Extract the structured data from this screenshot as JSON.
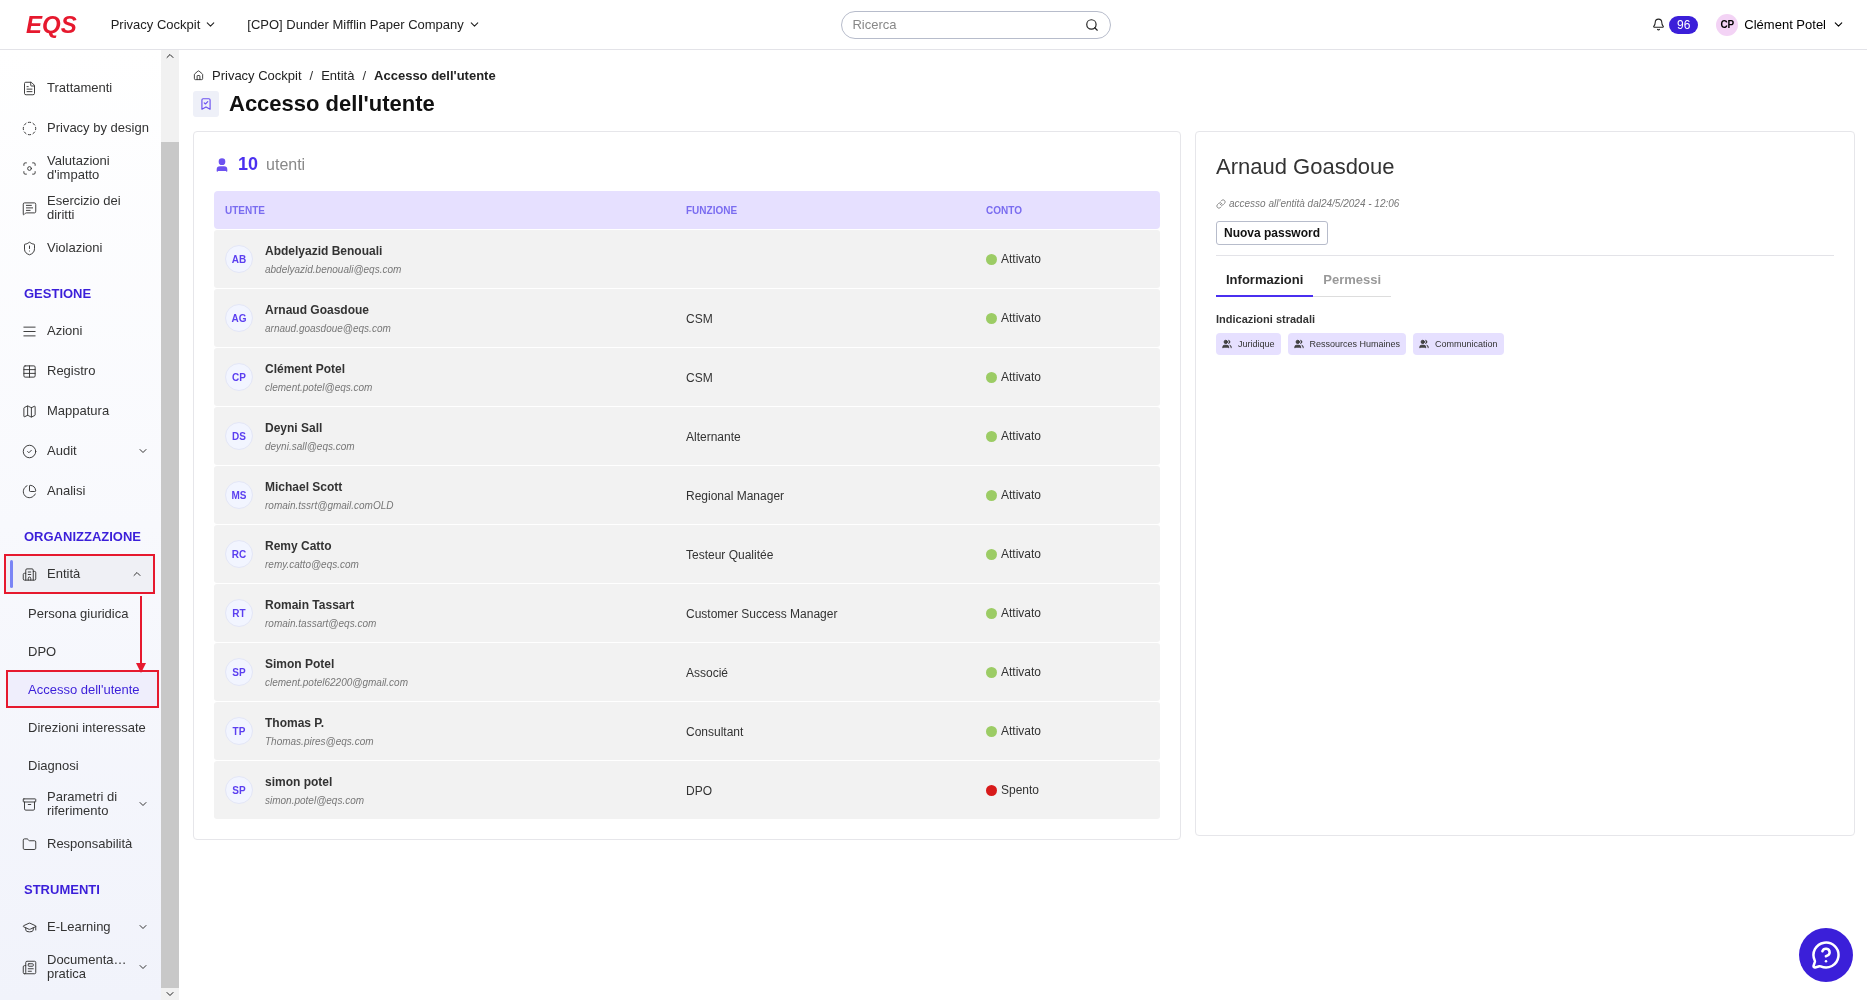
{
  "topbar": {
    "logo": "EQS",
    "menus": [
      {
        "label": "Privacy Cockpit"
      },
      {
        "label": "[CPO] Dunder Mifflin Paper Company"
      }
    ],
    "search": {
      "placeholder": "Ricerca"
    },
    "notifications": "96",
    "user": {
      "initials": "CP",
      "name": "Clément Potel"
    }
  },
  "sidebar": {
    "sections": [
      {
        "items": [
          {
            "label": "Trattamenti"
          },
          {
            "label": "Privacy by design"
          },
          {
            "label": "Valutazioni d'impatto"
          },
          {
            "label": "Esercizio dei diritti"
          },
          {
            "label": "Violazioni"
          }
        ]
      },
      {
        "title": "GESTIONE",
        "items": [
          {
            "label": "Azioni"
          },
          {
            "label": "Registro"
          },
          {
            "label": "Mappatura"
          },
          {
            "label": "Audit",
            "expanded": false
          },
          {
            "label": "Analisi"
          }
        ]
      },
      {
        "title": "ORGANIZZAZIONE",
        "items": [
          {
            "label": "Entità",
            "expanded": true,
            "active": true,
            "annotated": true,
            "children": [
              {
                "label": "Persona giuridica",
                "selected": false,
                "annotated": false
              },
              {
                "label": "DPO",
                "selected": false,
                "annotated": false
              },
              {
                "label": "Accesso dell'utente",
                "selected": true,
                "annotated": true
              },
              {
                "label": "Direzioni interessate",
                "selected": false,
                "annotated": false
              },
              {
                "label": "Diagnosi",
                "selected": false,
                "annotated": false
              }
            ]
          },
          {
            "label": "Parametri di riferimento",
            "expanded": false
          },
          {
            "label": "Responsabilità"
          }
        ]
      },
      {
        "title": "STRUMENTI",
        "items": [
          {
            "label": "E-Learning",
            "expanded": false
          },
          {
            "label": "Documenta… pratica",
            "expanded": false
          }
        ]
      }
    ]
  },
  "breadcrumb": [
    {
      "label": "Privacy Cockpit"
    },
    {
      "separator": "/",
      "label": "Entità"
    },
    {
      "separator": "/",
      "label": "Accesso dell'utente"
    }
  ],
  "page_title": "Accesso dell'utente",
  "users_panel": {
    "count": "10",
    "count_label": "utenti",
    "table": {
      "columns": [
        "UTENTE",
        "FUNZIONE",
        "CONTO"
      ],
      "rows": [
        {
          "initials": "AB",
          "name": "Abdelyazid Benouali",
          "email": "abdelyazid.benouali@eqs.com",
          "function": "",
          "status": {
            "label": "Attivato",
            "color": "#9ccc65"
          }
        },
        {
          "initials": "AG",
          "name": "Arnaud Goasdoue",
          "email": "arnaud.goasdoue@eqs.com",
          "function": "CSM",
          "status": {
            "label": "Attivato",
            "color": "#9ccc65"
          }
        },
        {
          "initials": "CP",
          "name": "Clément Potel",
          "email": "clement.potel@eqs.com",
          "function": "CSM",
          "status": {
            "label": "Attivato",
            "color": "#9ccc65"
          }
        },
        {
          "initials": "DS",
          "name": "Deyni Sall",
          "email": "deyni.sall@eqs.com",
          "function": "Alternante",
          "status": {
            "label": "Attivato",
            "color": "#9ccc65"
          }
        },
        {
          "initials": "MS",
          "name": "Michael Scott",
          "email": "romain.tssrt@gmail.comOLD",
          "function": "Regional Manager",
          "status": {
            "label": "Attivato",
            "color": "#9ccc65"
          }
        },
        {
          "initials": "RC",
          "name": "Remy Catto",
          "email": "remy.catto@eqs.com",
          "function": "Testeur Qualitée",
          "status": {
            "label": "Attivato",
            "color": "#9ccc65"
          }
        },
        {
          "initials": "RT",
          "name": "Romain Tassart",
          "email": "romain.tassart@eqs.com",
          "function": "Customer Success Manager",
          "status": {
            "label": "Attivato",
            "color": "#9ccc65"
          }
        },
        {
          "initials": "SP",
          "name": "Simon Potel",
          "email": "clement.potel62200@gmail.com",
          "function": "Associé",
          "status": {
            "label": "Attivato",
            "color": "#9ccc65"
          }
        },
        {
          "initials": "TP",
          "name": "Thomas P.",
          "email": "Thomas.pires@eqs.com",
          "function": "Consultant",
          "status": {
            "label": "Attivato",
            "color": "#9ccc65"
          }
        },
        {
          "initials": "SP",
          "name": "simon potel",
          "email": "simon.potel@eqs.com",
          "function": "DPO",
          "status": {
            "label": "Spento",
            "color": "#d81b1b"
          }
        }
      ]
    }
  },
  "detail": {
    "name": "Arnaud Goasdoue",
    "access": "accesso all'entità dal24/5/2024 - 12:06",
    "button": "Nuova password",
    "tabs": [
      {
        "label": "Informazioni",
        "selected": true
      },
      {
        "label": "Permessi",
        "selected": false
      }
    ],
    "section_title": "Indicazioni stradali",
    "chips": [
      "Juridique",
      "Ressources Humaines",
      "Communication"
    ]
  }
}
